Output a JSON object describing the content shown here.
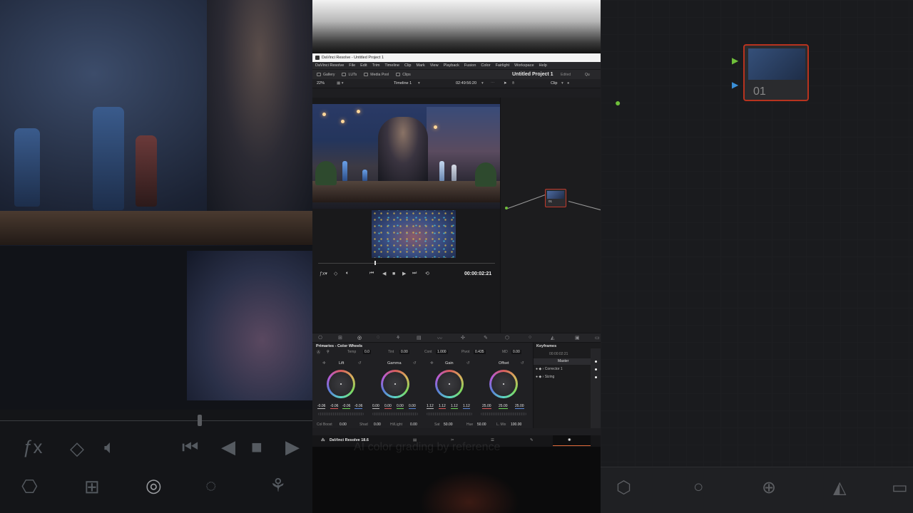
{
  "window": {
    "title": "DaVinci Resolve - Untitled Project 1"
  },
  "menu": [
    "DaVinci Resolve",
    "File",
    "Edit",
    "Trim",
    "Timeline",
    "Clip",
    "Mark",
    "View",
    "Playback",
    "Fusion",
    "Color",
    "Fairlight",
    "Workspace",
    "Help"
  ],
  "toolbar": {
    "gallery": "Gallery",
    "luts": "LUTs",
    "media_pool": "Media Pool",
    "clips": "Clips",
    "project_name": "Untitled Project 1",
    "status": "Edited",
    "quick": "Qu"
  },
  "viewer": {
    "zoom": "22%",
    "timeline_name": "Timeline 1",
    "source_tc": "02:49:56:20",
    "mode": "Clip",
    "timecode": "00:00:02:21"
  },
  "node": {
    "label": "01"
  },
  "primaries": {
    "title": "Primaries - Color Wheels",
    "temp_label": "Temp",
    "temp": "0.0",
    "tint_label": "Tint",
    "tint": "0.00",
    "cont_label": "Cont",
    "cont": "1.000",
    "pivot_label": "Pivot",
    "pivot": "0.435",
    "md_label": "MD",
    "md": "0.00",
    "wheels": [
      {
        "name": "Lift",
        "values": [
          "-0.06",
          "-0.06",
          "-0.06",
          "-0.06"
        ]
      },
      {
        "name": "Gamma",
        "values": [
          "0.00",
          "0.00",
          "0.00",
          "0.00"
        ]
      },
      {
        "name": "Gain",
        "values": [
          "1.12",
          "1.12",
          "1.12",
          "1.12"
        ]
      },
      {
        "name": "Offset",
        "values": [
          "25.00",
          "25.00",
          "25.00"
        ]
      }
    ],
    "col_boost_label": "Col Boost",
    "col_boost": "0.00",
    "shad_label": "Shad",
    "shad": "0.00",
    "hilight_label": "Hi/Light",
    "hilight": "0.00",
    "sat_label": "Sat",
    "sat": "50.00",
    "hue_label": "Hue",
    "hue": "50.00",
    "lmix_label": "L. Mix",
    "lmix": "100.00"
  },
  "keyframes": {
    "title": "Keyframes",
    "timecode": "00:00:02:21",
    "master": "Master",
    "items": [
      "Corrector 1",
      "Sizing"
    ]
  },
  "statusbar": {
    "app_version": "DaVinci Resolve 18.6"
  },
  "overlay_text": "AI color grading by reference",
  "colors": {
    "accent": "#e06a3a",
    "node_border": "#c0392b",
    "node_input": "#6fbf3a"
  }
}
